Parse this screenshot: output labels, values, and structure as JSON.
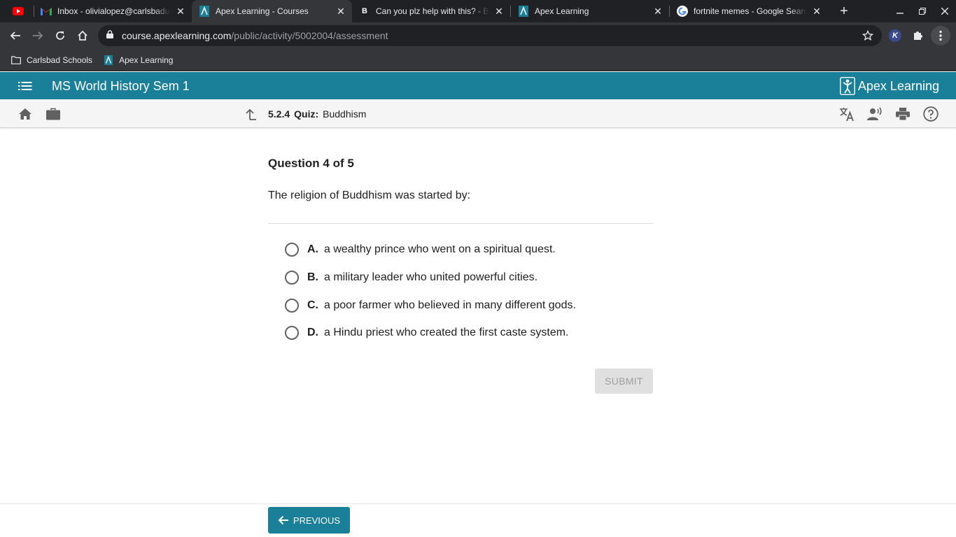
{
  "browser": {
    "tabs": [
      {
        "title": "",
        "favicon": "youtube-icon"
      },
      {
        "title": "Inbox - olivialopez@carlsbadusd.net",
        "favicon": "gmail-icon"
      },
      {
        "title": "Apex Learning - Courses",
        "favicon": "apex-icon",
        "active": true
      },
      {
        "title": "Can you plz help with this? - Brainly",
        "favicon": "brainly-icon"
      },
      {
        "title": "Apex Learning",
        "favicon": "apex-icon"
      },
      {
        "title": "fortnite memes - Google Search",
        "favicon": "google-icon"
      }
    ],
    "url_host": "course.apexlearning.com",
    "url_path": "/public/activity/5002004/assessment",
    "profile_initial": "K",
    "bookmarks": [
      {
        "label": "Carlsbad Schools",
        "icon": "folder-icon"
      },
      {
        "label": "Apex Learning",
        "icon": "apex-icon"
      }
    ]
  },
  "header": {
    "course_title": "MS World History Sem 1",
    "logo_text": "Apex Learning",
    "brand_color": "#1a7f98"
  },
  "subnav": {
    "lesson_number": "5.2.4",
    "activity_type": "Quiz:",
    "activity_title": "Buddhism"
  },
  "question": {
    "counter": "Question 4 of 5",
    "prompt": "The religion of Buddhism was started by:",
    "options": [
      {
        "letter": "A.",
        "text": "a wealthy prince who went on a spiritual quest."
      },
      {
        "letter": "B.",
        "text": "a military leader who united powerful cities."
      },
      {
        "letter": "C.",
        "text": "a poor farmer who believed in many different gods."
      },
      {
        "letter": "D.",
        "text": "a Hindu priest who created the first caste system."
      }
    ],
    "submit_label": "SUBMIT"
  },
  "footer": {
    "previous_label": "PREVIOUS"
  }
}
